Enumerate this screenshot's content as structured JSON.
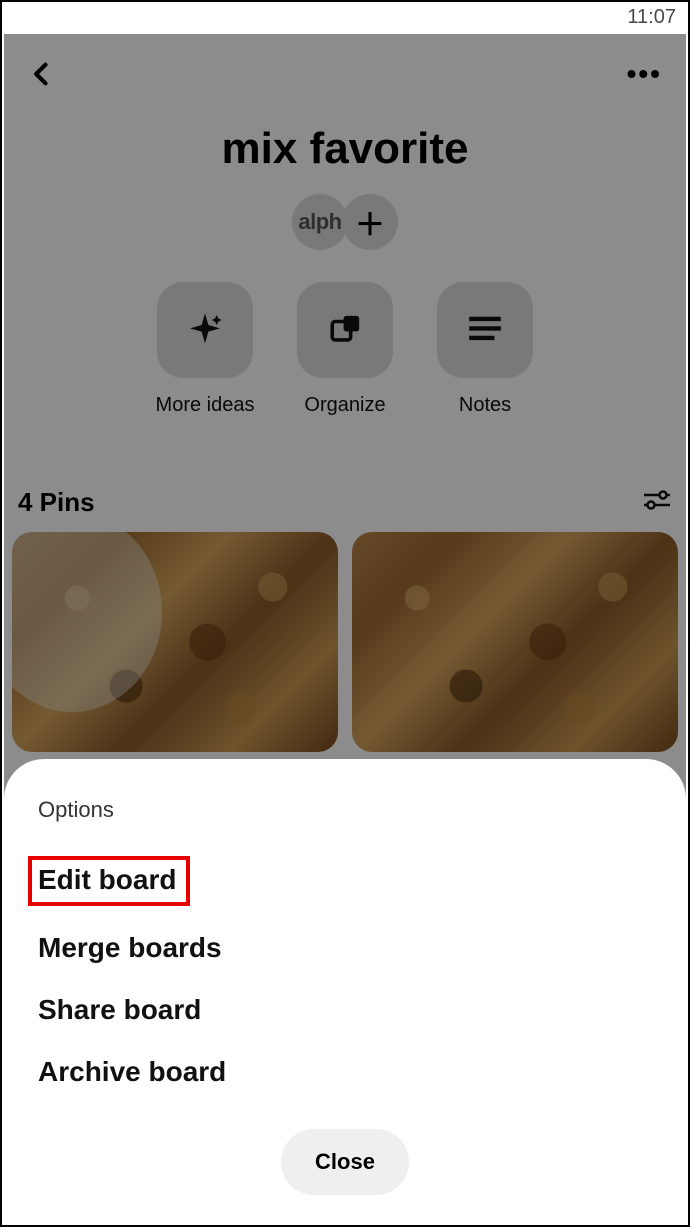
{
  "status": {
    "time": "11:07"
  },
  "board": {
    "title": "mix favorite",
    "collaborator_label": "alph",
    "actions": {
      "more_ideas": "More ideas",
      "organize": "Organize",
      "notes": "Notes"
    },
    "pins_count_label": "4 Pins"
  },
  "sheet": {
    "title": "Options",
    "options": {
      "edit": "Edit board",
      "merge": "Merge boards",
      "share": "Share board",
      "archive": "Archive board"
    },
    "close_label": "Close"
  }
}
